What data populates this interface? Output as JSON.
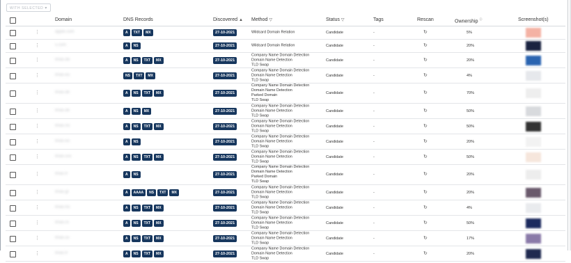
{
  "toolbar": {
    "with_selected": "WITH SELECTED",
    "with_selected_caret": "▾"
  },
  "table": {
    "headers": {
      "domain": "Domain",
      "dns_records": "DNS Records",
      "discovered": "Discovered",
      "discovered_sort": "▲",
      "method": "Method",
      "method_filter": "▽",
      "status": "Status",
      "status_filter": "▽",
      "tags": "Tags",
      "rescan": "Rescan",
      "ownership": "Ownership",
      "ownership_info": "ⓘ",
      "screenshots": "Screenshot(s)"
    },
    "rows": [
      {
        "domain": "apple.com",
        "dns": [
          "A",
          "TXT",
          "MX"
        ],
        "discovered": "27-10-2021",
        "method": [
          "Wildcard Domain Relation"
        ],
        "status": "Candidate",
        "tags": "-",
        "ownership": "5%",
        "shot_color": "#f4b2a4",
        "height": 18
      },
      {
        "domain": "s.com",
        "dns": [
          "A",
          "NS"
        ],
        "discovered": "27-10-2021",
        "method": [
          "Wildcard Domain Relation"
        ],
        "status": "Candidate",
        "tags": "-",
        "ownership": "20%",
        "shot_color": "#1a2340",
        "height": 18
      },
      {
        "domain": "lmao.de",
        "dns": [
          "A",
          "NS",
          "TXT",
          "MX"
        ],
        "discovered": "27-10-2021",
        "method": [
          "Company Name Domain Detection",
          "Domain Name Detection",
          "TLD Swap"
        ],
        "status": "Candidate",
        "tags": "-",
        "ownership": "20%",
        "shot_color": "#2a64b0",
        "height": 21
      },
      {
        "domain": "lmao.eu",
        "dns": [
          "NS",
          "TXT",
          "MX"
        ],
        "discovered": "27-10-2021",
        "method": [
          "Company Name Domain Detection",
          "Domain Name Detection",
          "TLD Swap"
        ],
        "status": "Candidate",
        "tags": "-",
        "ownership": "4%",
        "shot_color": "#e6e8ec",
        "height": 21
      },
      {
        "domain": "lmao.dk",
        "dns": [
          "A",
          "NS",
          "TXT",
          "MX"
        ],
        "discovered": "27-10-2021",
        "method": [
          "Company Name Domain Detection",
          "Domain Name Detection",
          "Parked Domain",
          "TLD Swap"
        ],
        "status": "Candidate",
        "tags": "-",
        "ownership": "70%",
        "shot_color": "#eeeeee",
        "height": 28
      },
      {
        "domain": "lmao.dk",
        "dns": [
          "A",
          "NS",
          "MX"
        ],
        "discovered": "27-10-2021",
        "method": [
          "Company Name Domain Detection",
          "Domain Name Detection",
          "TLD Swap"
        ],
        "status": "Candidate",
        "tags": "-",
        "ownership": "50%",
        "shot_color": "#d8dadd",
        "height": 21
      },
      {
        "domain": "lmao.no",
        "dns": [
          "A",
          "NS",
          "TXT",
          "MX"
        ],
        "discovered": "27-10-2021",
        "method": [
          "Company Name Domain Detection",
          "Domain Name Detection",
          "TLD Swap"
        ],
        "status": "Candidate",
        "tags": "-",
        "ownership": "50%",
        "shot_color": "#333333",
        "height": 21
      },
      {
        "domain": "lmao.eu",
        "dns": [
          "A",
          "NS"
        ],
        "discovered": "27-10-2021",
        "method": [
          "Company Name Domain Detection",
          "Domain Name Detection",
          "TLD Swap"
        ],
        "status": "Candidate",
        "tags": "-",
        "ownership": "20%",
        "shot_color": "#f2f2f2",
        "height": 21
      },
      {
        "domain": "lmao.xxx",
        "dns": [
          "A",
          "NS",
          "TXT",
          "MX"
        ],
        "discovered": "27-10-2021",
        "method": [
          "Company Name Domain Detection",
          "Domain Name Detection",
          "TLD Swap"
        ],
        "status": "Candidate",
        "tags": "-",
        "ownership": "50%",
        "shot_color": "#f6e6dc",
        "height": 21
      },
      {
        "domain": "lmao.fr",
        "dns": [
          "A",
          "NS"
        ],
        "discovered": "27-10-2021",
        "method": [
          "Company Name Domain Detection",
          "Domain Name Detection",
          "Parked Domain",
          "TLD Swap"
        ],
        "status": "Candidate",
        "tags": "-",
        "ownership": "20%",
        "shot_color": "#ededed",
        "height": 28
      },
      {
        "domain": "lmao.gr",
        "dns": [
          "A",
          "AAAA",
          "NS",
          "TXT",
          "MX"
        ],
        "discovered": "27-10-2021",
        "method": [
          "Company Name Domain Detection",
          "Domain Name Detection",
          "TLD Swap"
        ],
        "status": "Candidate",
        "tags": "-",
        "ownership": "20%",
        "shot_color": "#6a5a6c",
        "height": 21
      },
      {
        "domain": "lmao.ho",
        "dns": [
          "A",
          "NS",
          "TXT",
          "MX"
        ],
        "discovered": "27-10-2021",
        "method": [
          "Company Name Domain Detection",
          "Domain Name Detection",
          "TLD Swap"
        ],
        "status": "Candidate",
        "tags": "-",
        "ownership": "4%",
        "shot_color": "#e9ebee",
        "height": 21
      },
      {
        "domain": "lmao.ro",
        "dns": [
          "A",
          "NS",
          "TXT",
          "MX"
        ],
        "discovered": "27-10-2021",
        "method": [
          "Company Name Domain Detection",
          "Domain Name Detection",
          "TLD Swap"
        ],
        "status": "Candidate",
        "tags": "-",
        "ownership": "50%",
        "shot_color": "#1c2a5e",
        "height": 21
      },
      {
        "domain": "lmao.xx",
        "dns": [
          "A",
          "NS",
          "TXT",
          "MX"
        ],
        "discovered": "27-10-2021",
        "method": [
          "Company Name Domain Detection",
          "Domain Name Detection",
          "TLD Swap"
        ],
        "status": "Candidate",
        "tags": "-",
        "ownership": "17%",
        "shot_color": "#8a7aa8",
        "height": 21
      },
      {
        "domain": "lmao.fr",
        "dns": [
          "A",
          "NS",
          "TXT",
          "MX"
        ],
        "discovered": "27-10-2021",
        "method": [
          "Company Name Domain Detection",
          "Domain Name Detection",
          "TLD Swap"
        ],
        "status": "Candidate",
        "tags": "-",
        "ownership": "20%",
        "shot_color": "#202a50",
        "height": 21
      }
    ]
  },
  "icons": {
    "kebab": "⋮",
    "rescan": "↻"
  }
}
